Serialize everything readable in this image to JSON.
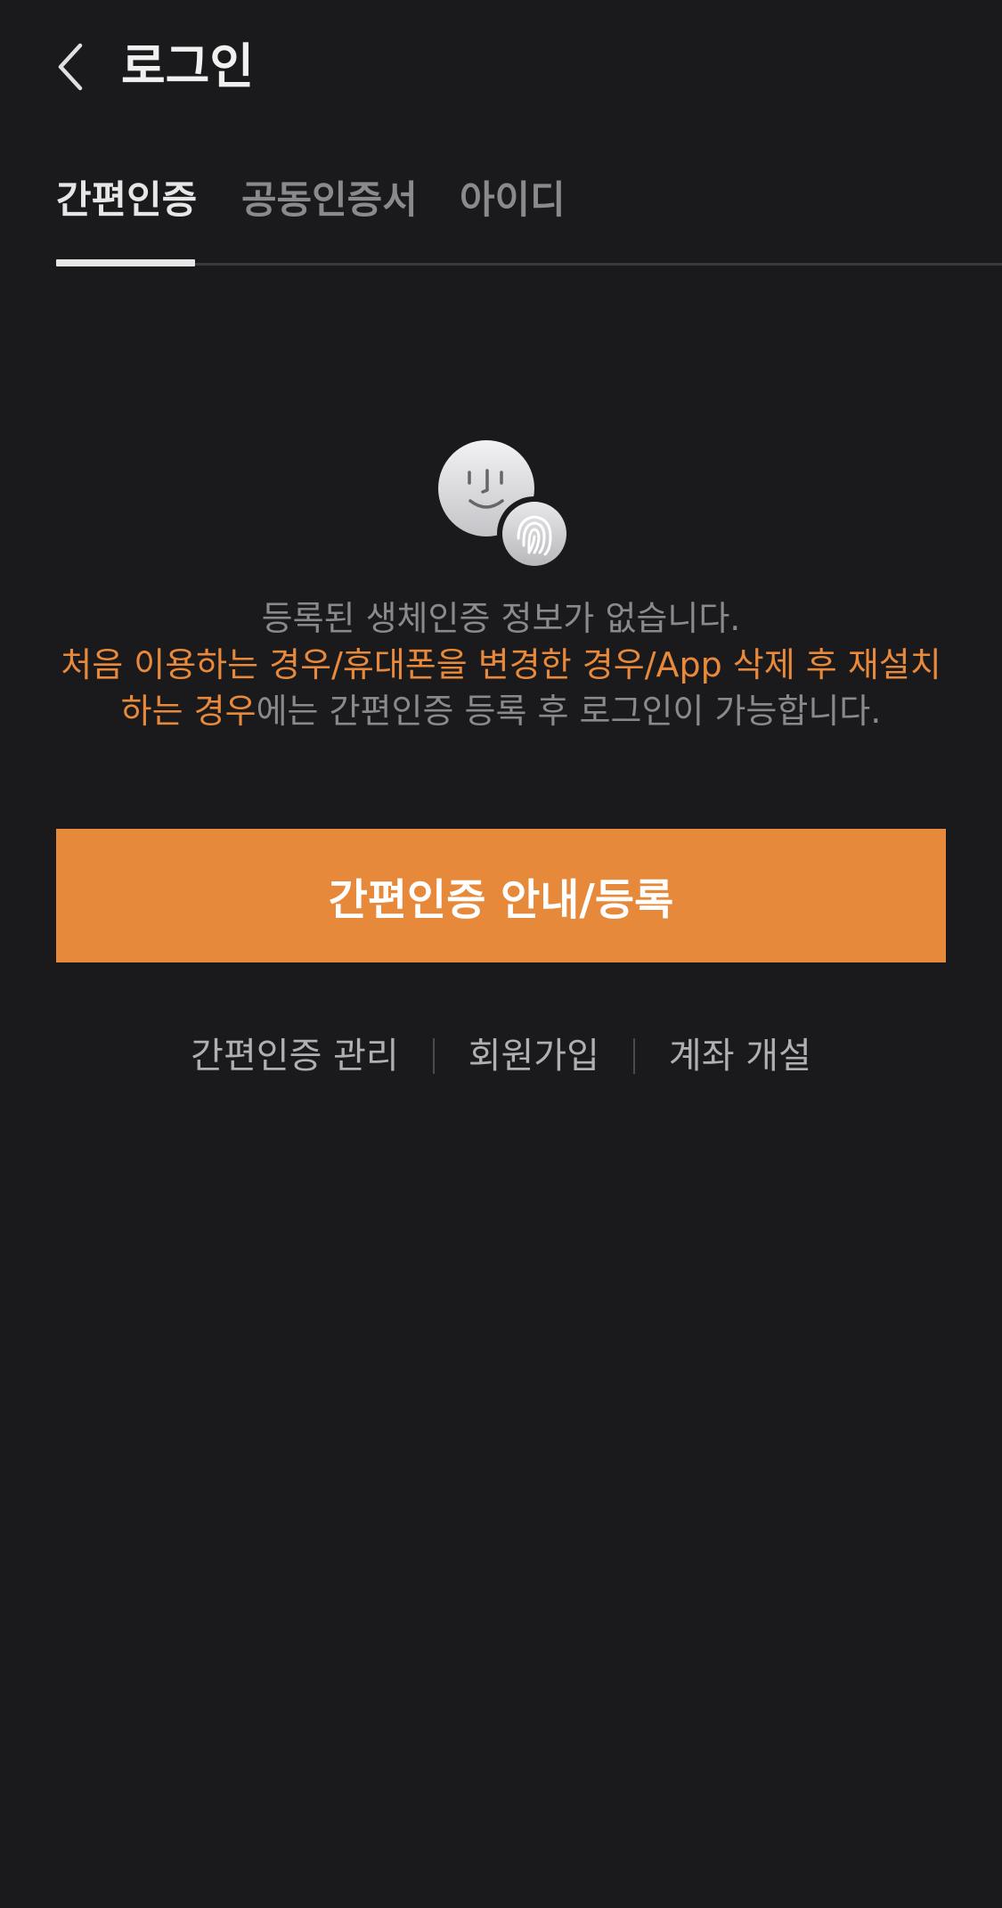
{
  "header": {
    "back_icon": "chevron-left-icon",
    "title": "로그인"
  },
  "tabs": [
    {
      "label": "간편인증",
      "active": true
    },
    {
      "label": "공동인증서",
      "active": false
    },
    {
      "label": "아이디",
      "active": false
    }
  ],
  "bio_icon": "face-fingerprint-icon",
  "notice": {
    "line1": "등록된 생체인증 정보가 없습니다.",
    "highlight": "처음 이용하는 경우/휴대폰을 변경한 경우/App 삭제 후 재설치 하는 경우",
    "tail": "에는 간편인증 등록 후 로그인이 가능합니다."
  },
  "primary_button": {
    "label": "간편인증 안내/등록"
  },
  "links": [
    {
      "label": "간편인증 관리"
    },
    {
      "label": "회원가입"
    },
    {
      "label": "계좌 개설"
    }
  ],
  "colors": {
    "background": "#1a1a1c",
    "accent": "#e6893b",
    "text_primary": "#e6e6e6",
    "text_muted": "#8a8a8c"
  }
}
